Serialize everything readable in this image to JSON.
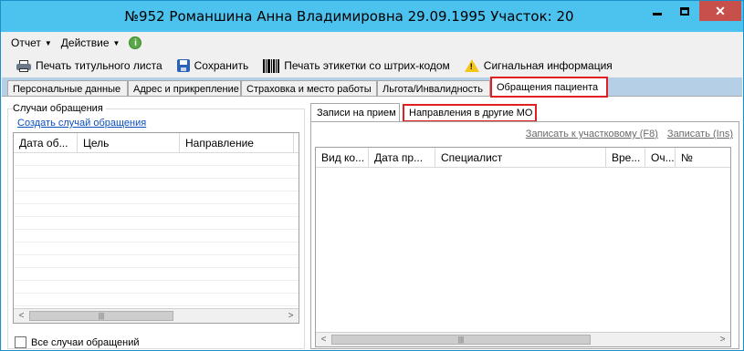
{
  "window": {
    "title": "№952 Романшина Анна Владимировна 29.09.1995 Участок: 20",
    "close_glyph": "✕",
    "titlebar_color": "#4cc2ef",
    "close_color": "#c7504b"
  },
  "menu": {
    "report": "Отчет",
    "action": "Действие",
    "info_icon": "info-icon"
  },
  "toolbar": {
    "print_title": "Печать титульного листа",
    "save": "Сохранить",
    "print_barcode": "Печать этикетки со штрих-кодом",
    "signal_info": "Сигнальная информация"
  },
  "tabs": [
    {
      "label": "Персональные данные"
    },
    {
      "label": "Адрес и прикрепление"
    },
    {
      "label": "Страховка и место работы"
    },
    {
      "label": "Льгота/Инвалидность"
    },
    {
      "label": "Обращения пациента",
      "active": true
    }
  ],
  "left": {
    "group_title": "Случаи обращения",
    "create_link": "Создать случай обращения",
    "columns": [
      "Дата об...",
      "Цель",
      "Направление"
    ],
    "all_cases_label": "Все случаи обращений",
    "all_cases_checked": false
  },
  "right": {
    "subtabs": [
      {
        "label": "Записи на прием",
        "active": true
      },
      {
        "label": "Направления в другие МО"
      }
    ],
    "action_assign_local": "Записать к участковому (F8)",
    "action_assign": "Записать (Ins)",
    "columns": [
      "Вид ко...",
      "Дата пр...",
      "Специалист",
      "Вре...",
      "Оч...",
      "№"
    ]
  },
  "highlight_color": "#e02020"
}
